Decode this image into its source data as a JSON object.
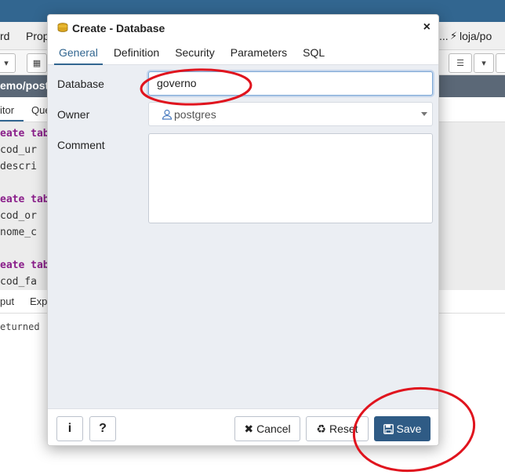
{
  "background": {
    "menubar": [
      "rd",
      "Prop",
      "...",
      "loja/po"
    ],
    "path_title": "emo/post",
    "subtabs": [
      "itor",
      "Que"
    ],
    "editor_lines": [
      {
        "kw": "eate",
        "rest": " tab"
      },
      {
        "kw": "",
        "rest": "  cod_ur"
      },
      {
        "kw": "",
        "rest": "  descri"
      },
      {
        "kw": "eate",
        "rest": " tab"
      },
      {
        "kw": "",
        "rest": "  cod_or"
      },
      {
        "kw": "",
        "rest": "  nome_c"
      },
      {
        "kw": "eate",
        "rest": " tab"
      },
      {
        "kw": "",
        "rest": "  cod_fa"
      }
    ],
    "output_tabs": [
      "put",
      "Exp"
    ],
    "output_text": "eturned"
  },
  "dialog": {
    "title": "Create - Database",
    "close_label": "×",
    "tabs": [
      "General",
      "Definition",
      "Security",
      "Parameters",
      "SQL"
    ],
    "active_tab": 0,
    "form": {
      "database_label": "Database",
      "database_value": "governo",
      "owner_label": "Owner",
      "owner_value": "postgres",
      "comment_label": "Comment",
      "comment_value": ""
    },
    "footer": {
      "info_label": "i",
      "help_label": "?",
      "cancel_icon": "✖",
      "cancel_label": "Cancel",
      "reset_icon": "♻",
      "reset_label": "Reset",
      "save_label": "Save"
    }
  },
  "colors": {
    "accent": "#326690",
    "save_button": "#2f5b85",
    "annotation": "#e0141e"
  }
}
